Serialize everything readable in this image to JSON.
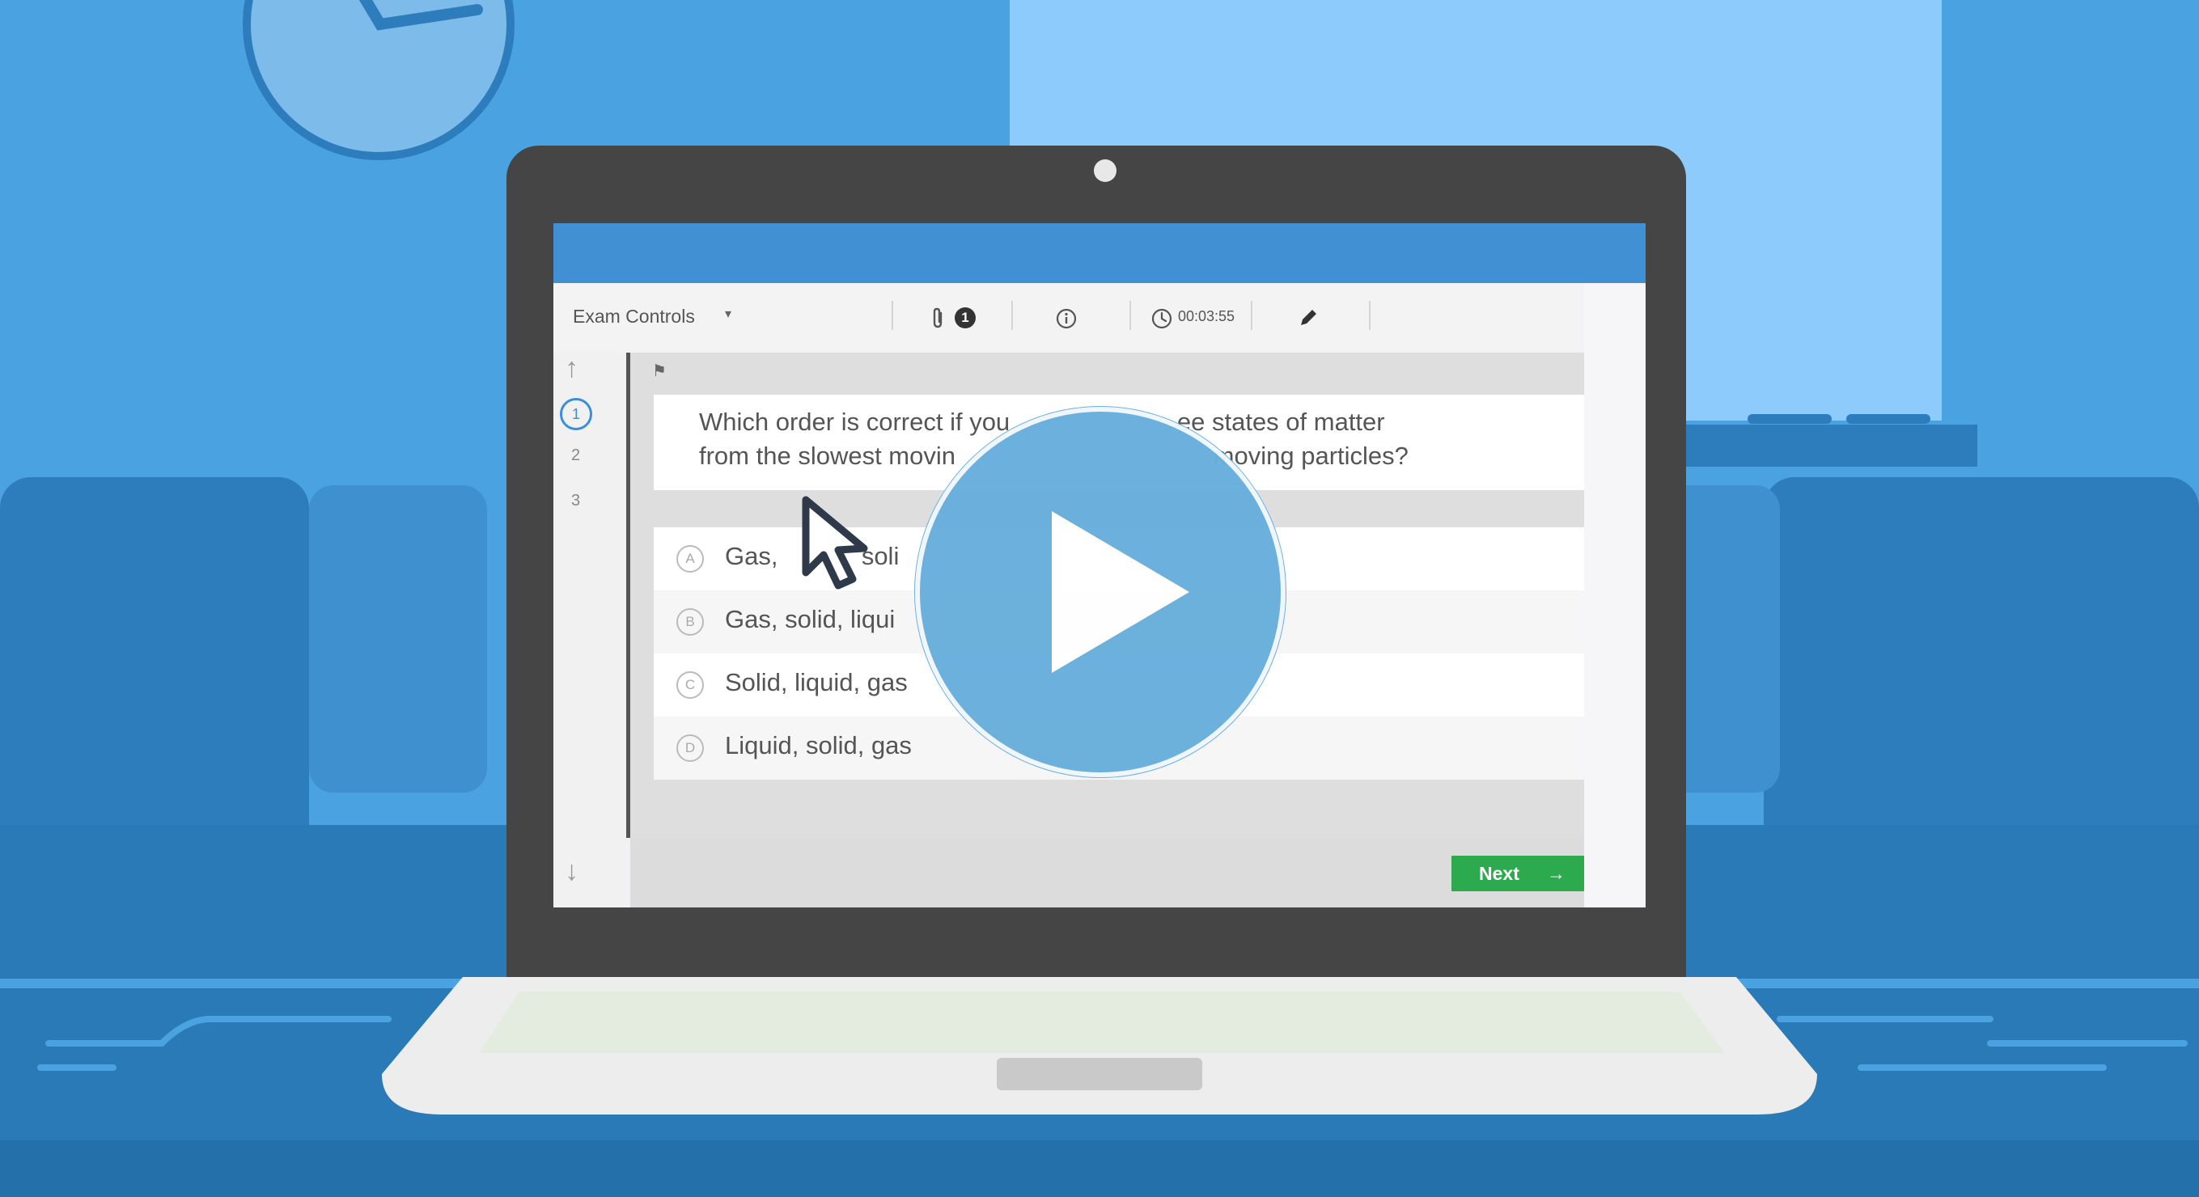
{
  "colors": {
    "wall": "#4aa3e0",
    "accent_blue": "#4290d4",
    "next_green": "#2daa4e",
    "play": "#68aedc",
    "selected_question": "#3a8fd8"
  },
  "exam": {
    "controls_label": "Exam Controls",
    "controls_caret": "▾",
    "attachment_count": "1",
    "timer": "00:03:55",
    "icons": {
      "attachment": "paperclip-icon",
      "info": "info-icon",
      "clock": "clock-icon",
      "pencil": "pencil-icon",
      "flag": "flag-icon"
    },
    "nav": {
      "up_arrow": "↑",
      "down_arrow": "↓",
      "questions": [
        "1",
        "2",
        "3"
      ]
    },
    "flag_glyph": "⚑",
    "question": {
      "line1": "Which order is correct if you                        ee states of matter",
      "line2": "from the slowest movin                                     moving particles?"
    },
    "options": [
      {
        "letter": "A",
        "text": "Gas,            soli"
      },
      {
        "letter": "B",
        "text": "Gas, solid, liqui"
      },
      {
        "letter": "C",
        "text": "Solid, liquid, gas"
      },
      {
        "letter": "D",
        "text": "Liquid, solid, gas"
      }
    ],
    "next_label": "Next",
    "next_arrow": "→"
  },
  "video": {
    "play_icon": "play-icon",
    "cursor_icon": "mouse-pointer-icon"
  }
}
